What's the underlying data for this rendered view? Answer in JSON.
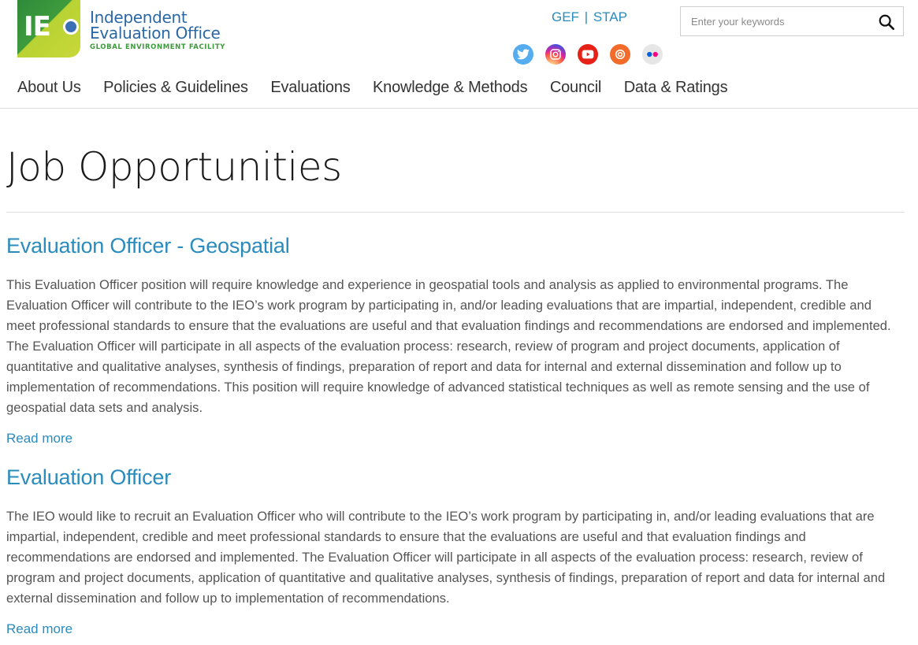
{
  "logo": {
    "mark_text": "IE",
    "line1": "Independent",
    "line2": "Evaluation Office",
    "line3": "GLOBAL ENVIRONMENT FACILITY"
  },
  "toplinks": {
    "gef": "GEF",
    "separator": "|",
    "stap": "STAP"
  },
  "social": [
    "twitter-icon",
    "instagram-icon",
    "youtube-icon",
    "issuu-icon",
    "flickr-icon"
  ],
  "search": {
    "placeholder": "Enter your keywords",
    "value": ""
  },
  "nav": {
    "items": [
      "About Us",
      "Policies & Guidelines",
      "Evaluations",
      "Knowledge & Methods",
      "Council",
      "Data & Ratings"
    ]
  },
  "page": {
    "title": "Job Opportunities",
    "jobs": [
      {
        "title": "Evaluation Officer - Geospatial",
        "description": "This Evaluation Officer position will require knowledge and experience in geospatial tools and analysis as applied to environmental programs. The Evaluation Officer will contribute to the IEO’s work program by participating in, and/or leading evaluations that are impartial, independent, credible and meet professional standards to ensure that the evaluations are useful and that evaluation findings and recommendations are endorsed and implemented. The Evaluation Officer will participate in all aspects of the evaluation process: research, review of program and project documents, application of quantitative and qualitative analyses, synthesis of findings, preparation of report and data for internal and external dissemination and follow up to implementation of recommendations. This position will require knowledge of advanced statistical techniques as well as remote sensing and the use of geospatial data sets and analysis.",
        "read_more": "Read more"
      },
      {
        "title": "Evaluation Officer",
        "description": "The IEO would like to recruit an Evaluation Officer who will contribute to the IEO’s work program by participating in, and/or leading evaluations that are impartial, independent, credible and meet professional standards to ensure that the evaluations are useful and that evaluation findings and recommendations are endorsed and implemented. The Evaluation Officer will participate in all aspects of the evaluation process: research, review of program and project documents, application of quantitative and qualitative analyses, synthesis of findings, preparation of report and data for internal and external dissemination and follow up to implementation of recommendations.",
        "read_more": "Read more"
      }
    ]
  },
  "colors": {
    "link": "#2a8bbd",
    "brand_blue": "#2a67a7",
    "brand_green": "#3d9a3c"
  }
}
